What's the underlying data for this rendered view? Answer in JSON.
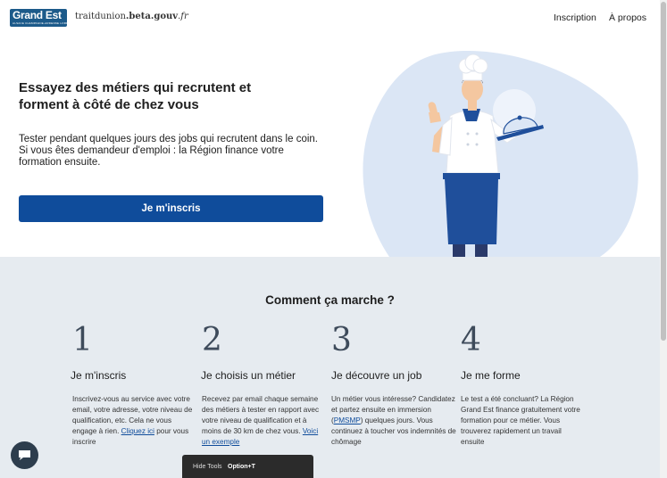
{
  "header": {
    "logo_text": "Grand Est",
    "logo_tagline": "ALSACE CHAMPAGNE-ARDENNE LORRAINE",
    "site_url": {
      "domain": "traitdunion",
      "dot": ".",
      "beta": "beta.gouv",
      "tld": ".fr"
    },
    "nav": [
      "Inscription",
      "À propos"
    ]
  },
  "hero": {
    "title": "Essayez des métiers qui recrutent et forment à côté de chez vous",
    "description": "Tester pendant quelques jours des jobs qui recrutent dans le coin. Si vous êtes demandeur d'emploi : la Région finance votre formation ensuite.",
    "cta_label": "Je m'inscris"
  },
  "how_it_works": {
    "heading": "Comment ça marche ?",
    "steps": [
      {
        "number": "1",
        "title": "Je m'inscris",
        "text_before": "Inscrivez-vous au service avec votre email, votre adresse, votre niveau de qualification, etc. Cela ne vous engage à rien. ",
        "link": "Cliquez ici",
        "text_after": " pour vous inscrire"
      },
      {
        "number": "2",
        "title": "Je choisis un métier",
        "text_before": "Recevez par email chaque semaine des métiers à tester en rapport avec votre niveau de qualification et à moins de 30 km de chez vous. ",
        "link": "Voici un exemple",
        "text_after": ""
      },
      {
        "number": "3",
        "title": "Je découvre un job",
        "text_before": "Un métier vous intéresse? Candidatez et partez ensuite en immersion (",
        "link": "PMSMP",
        "text_after": ") quelques jours. Vous continuez à toucher vos indemnités de chômage"
      },
      {
        "number": "4",
        "title": "Je me forme",
        "text_before": "Le test a été concluant? La Région Grand Est finance gratuitement votre formation pour ce métier. Vous trouverez rapidement un travail ensuite",
        "link": "",
        "text_after": ""
      }
    ]
  },
  "devtools": {
    "label": "Hide Tools",
    "shortcut": "Option+T"
  },
  "colors": {
    "primary": "#0f4c9b",
    "section_bg": "#e6ebf0",
    "blob": "#dbe6f5",
    "logo_bg": "#1c5a8a"
  }
}
